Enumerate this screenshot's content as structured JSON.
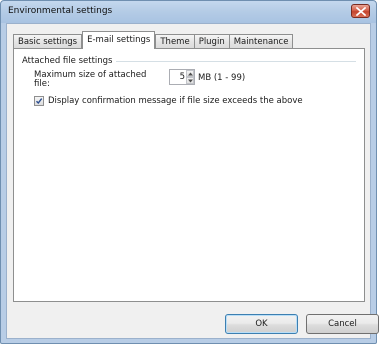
{
  "window": {
    "title": "Environmental settings"
  },
  "tabs": [
    {
      "label": "Basic settings"
    },
    {
      "label": "E-mail settings"
    },
    {
      "label": "Theme"
    },
    {
      "label": "Plugin"
    },
    {
      "label": "Maintenance"
    }
  ],
  "active_tab": "E-mail settings",
  "attached": {
    "group_title": "Attached file settings",
    "max_size_label": "Maximum size of attached file:",
    "max_size_value": "5",
    "unit_label": "MB (1 - 99)",
    "confirm_label": "Display confirmation message if file size exceeds the above",
    "confirm_checked": true
  },
  "buttons": {
    "ok": "OK",
    "cancel": "Cancel"
  },
  "icons": {
    "close": "close-icon",
    "spin_up": "spin-up-arrow-icon",
    "spin_down": "spin-down-arrow-icon",
    "check": "checkmark-icon"
  }
}
